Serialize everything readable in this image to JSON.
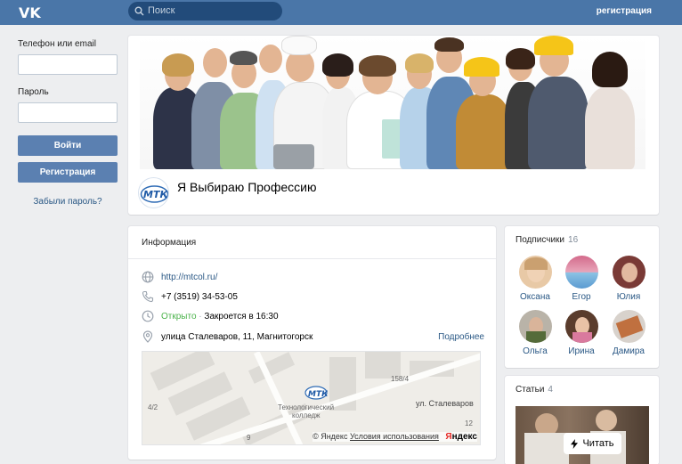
{
  "header": {
    "logo_icon": "vk-logo-icon",
    "search_placeholder": "Поиск",
    "register_link": "регистрация"
  },
  "login": {
    "phone_label": "Телефон или email",
    "password_label": "Пароль",
    "login_button": "Войти",
    "register_button": "Регистрация",
    "forgot_link": "Забыли пароль?"
  },
  "group": {
    "name": "Я Выбираю Профессию",
    "avatar_text": "МТК"
  },
  "info": {
    "title": "Информация",
    "website": "http://mtcol.ru/",
    "phone": "+7 (3519) 34-53-05",
    "status_open": "Открыто",
    "status_sep": " · ",
    "status_close": "Закроется в 16:30",
    "address": "улица Сталеваров, 11, Магнитогорск",
    "more_link": "Подробнее",
    "map": {
      "college_line1": "Технологический",
      "college_line2": "колледж",
      "street": "ул. Сталеваров",
      "house_158": "158/4",
      "house_42": "4/2",
      "house_12": "12",
      "house_9": "9",
      "copyright": "© Яндекс",
      "terms": "Условия использования",
      "brand_first": "Я",
      "brand_rest": "ндекс"
    }
  },
  "subscribers": {
    "title": "Подписчики",
    "count": "16",
    "people": [
      {
        "name": "Оксана"
      },
      {
        "name": "Егор"
      },
      {
        "name": "Юлия"
      },
      {
        "name": "Ольга"
      },
      {
        "name": "Ирина"
      },
      {
        "name": "Дамира"
      }
    ]
  },
  "articles": {
    "title": "Статьи",
    "count": "4",
    "read_button": "Читать"
  },
  "colors": {
    "header_bg": "#4a76a8",
    "button_bg": "#5b80b1",
    "link": "#2a5885",
    "open_green": "#4bb34b",
    "page_bg": "#edeef0"
  }
}
